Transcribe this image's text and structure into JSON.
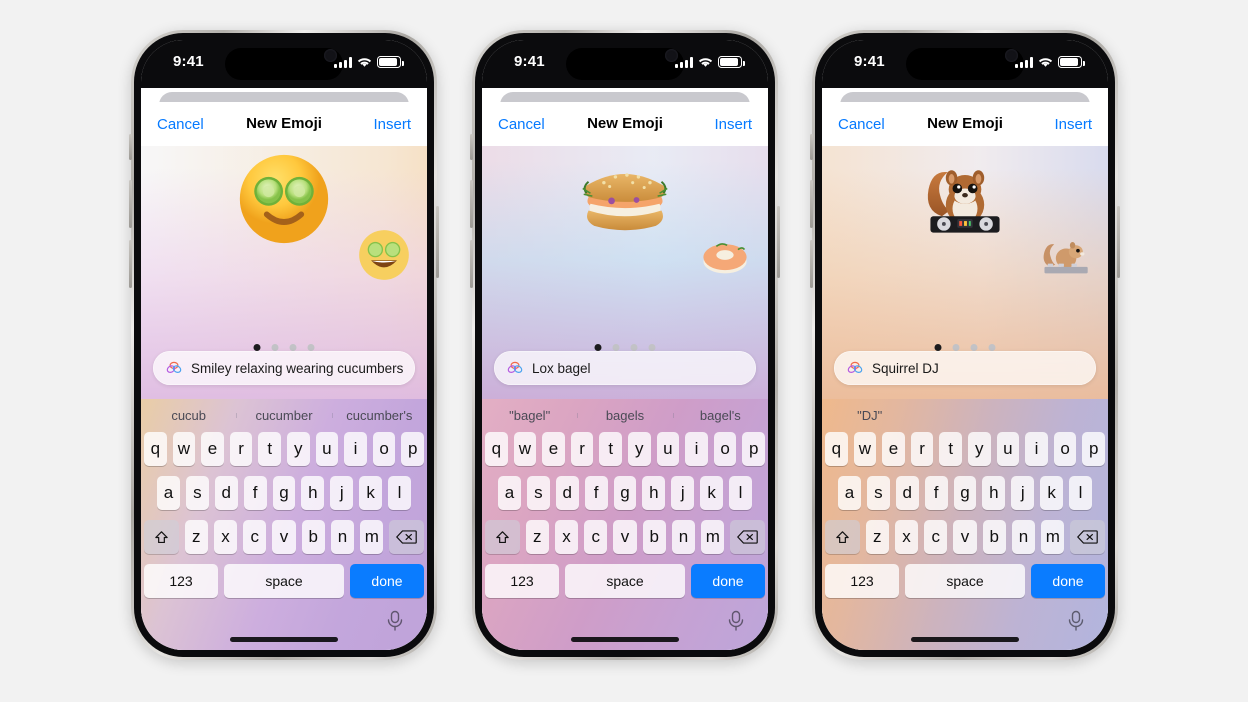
{
  "background_color": "#f2f2f2",
  "accent_color": "#067aff",
  "done_key_color": "#0a7cff",
  "status_bar": {
    "time": "9:41",
    "signal_icon": "cellular-bars-icon",
    "wifi_icon": "wifi-icon",
    "battery_icon": "battery-icon"
  },
  "navbar": {
    "cancel_label": "Cancel",
    "title": "New Emoji",
    "insert_label": "Insert"
  },
  "keyboard": {
    "row1": [
      "q",
      "w",
      "e",
      "r",
      "t",
      "y",
      "u",
      "i",
      "o",
      "p"
    ],
    "row2": [
      "a",
      "s",
      "d",
      "f",
      "g",
      "h",
      "j",
      "k",
      "l"
    ],
    "row3": [
      "z",
      "x",
      "c",
      "v",
      "b",
      "n",
      "m"
    ],
    "shift_icon": "shift-arrow-icon",
    "delete_icon": "backspace-delete-icon",
    "numbers_label": "123",
    "space_label": "space",
    "done_label": "done",
    "mic_icon": "microphone-icon"
  },
  "page_dots": {
    "count": 4,
    "active_index": 0
  },
  "phones": [
    {
      "id": "phone-cucumber",
      "prompt_text": "Smiley relaxing wearing cucumbers",
      "prompt_icon": "apple-intelligence-icon",
      "emoji_main": "🥒",
      "emoji_main_label": "cucumber-eyes-smiley-emoji",
      "emoji_next_label": "cucumber-eyes-grin-emoji",
      "predictions": [
        "cucub",
        "cucumber",
        "cucumber's"
      ],
      "gradient": {
        "left": "#f0c89a",
        "mid": "#d9b6de",
        "right": "#b9a7d8"
      }
    },
    {
      "id": "phone-bagel",
      "prompt_text": "Lox bagel",
      "prompt_icon": "apple-intelligence-icon",
      "emoji_main": "🥯",
      "emoji_main_label": "lox-bagel-emoji",
      "emoji_next_label": "open-lox-bagel-emoji",
      "predictions": [
        "\"bagel\"",
        "bagels",
        "bagel's"
      ],
      "gradient": {
        "left": "#d9a9c0",
        "mid": "#cf9fc6",
        "right": "#c3a3d5"
      }
    },
    {
      "id": "phone-squirrel",
      "prompt_text": "Squirrel DJ",
      "prompt_icon": "apple-intelligence-icon",
      "emoji_main": "🐿",
      "emoji_main_label": "squirrel-dj-emoji",
      "emoji_next_label": "squirrel-dj-side-emoji",
      "predictions": [
        "\"DJ\"",
        "",
        ""
      ],
      "gradient": {
        "left": "#eab489",
        "mid": "#cdb7c9",
        "right": "#b3b4dd"
      }
    }
  ]
}
